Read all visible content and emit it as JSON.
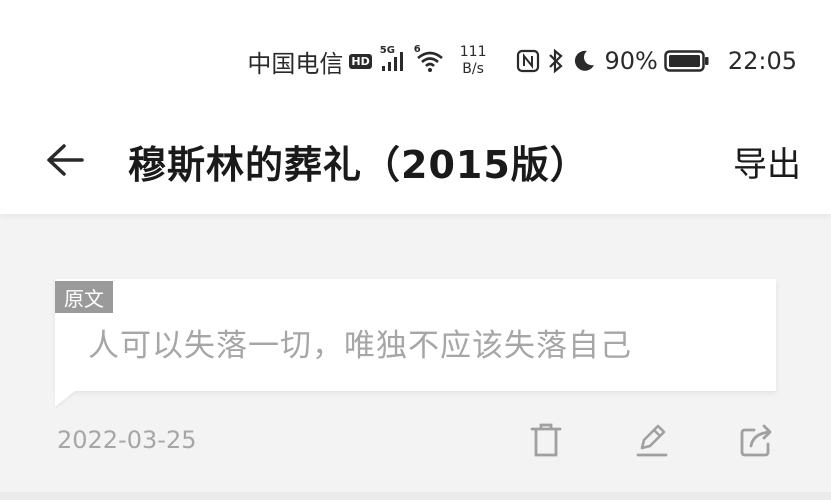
{
  "status_bar": {
    "carrier": "中国电信",
    "hd": "HD",
    "signal_tag": "5G",
    "wifi_tag": "6",
    "speed_value": "111",
    "speed_unit": "B/s",
    "battery": "90%",
    "time": "22:05"
  },
  "header": {
    "title": "穆斯林的葬礼（2015版）",
    "export_label": "导出"
  },
  "entry": {
    "tag": "原文",
    "text": "人可以失落一切，唯独不应该失落自己",
    "date": "2022-03-25"
  },
  "colors": {
    "tag_bg": "#9a9a9a",
    "muted_text": "#a6a6a6",
    "icon": "#a0a0a0"
  },
  "icons": [
    "back-arrow-icon",
    "delete-icon",
    "edit-icon",
    "share-icon"
  ]
}
